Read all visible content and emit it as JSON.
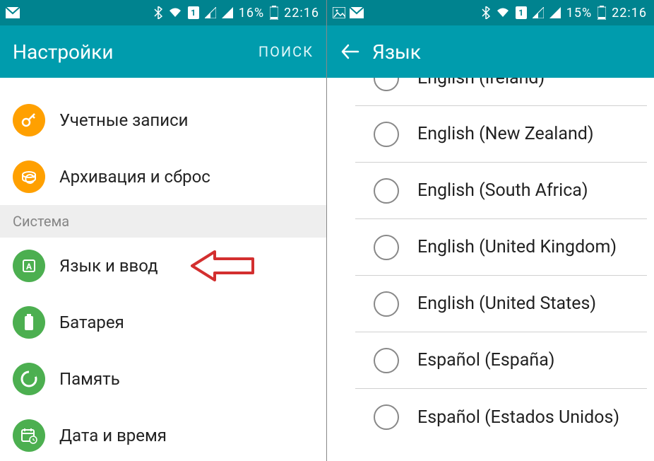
{
  "left": {
    "status": {
      "battery": "16%",
      "time": "22:16",
      "sim": "1"
    },
    "appbar": {
      "title": "Настройки",
      "action": "ПОИСК"
    },
    "items": [
      {
        "label": "Учетные записи",
        "icon": "key-icon",
        "color": "orange"
      },
      {
        "label": "Архивация и сброс",
        "icon": "reset-icon",
        "color": "orange"
      }
    ],
    "section": "Система",
    "system_items": [
      {
        "label": "Язык и ввод",
        "icon": "language-a-icon"
      },
      {
        "label": "Батарея",
        "icon": "battery-icon"
      },
      {
        "label": "Память",
        "icon": "storage-icon"
      },
      {
        "label": "Дата и время",
        "icon": "calendar-icon"
      }
    ]
  },
  "right": {
    "status": {
      "battery": "15%",
      "time": "22:16",
      "sim": "1"
    },
    "appbar": {
      "title": "Язык"
    },
    "languages": [
      "English (Ireland)",
      "English (New Zealand)",
      "English (South Africa)",
      "English (United Kingdom)",
      "English (United States)",
      "Español (España)",
      "Español (Estados Unidos)"
    ]
  },
  "annotation": {
    "type": "arrow-left",
    "color": "#d32f2f"
  }
}
